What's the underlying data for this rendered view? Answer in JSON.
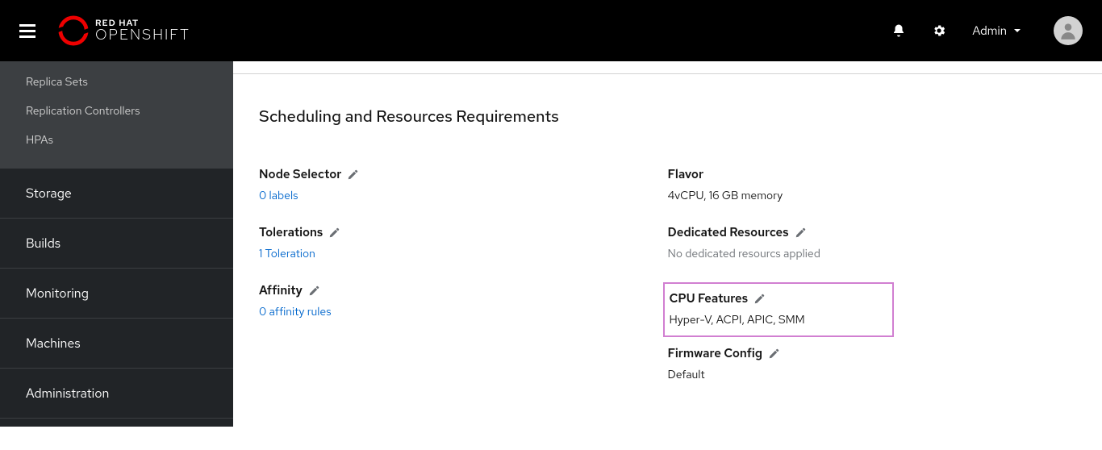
{
  "header": {
    "brand_top": "RED HAT",
    "brand_bottom": "OPENSHIFT",
    "user_label": "Admin"
  },
  "sidebar": {
    "sub_items": [
      "Replica Sets",
      "Replication Controllers",
      "HPAs"
    ],
    "main_items": [
      "Storage",
      "Builds",
      "Monitoring",
      "Machines",
      "Administration"
    ]
  },
  "main": {
    "section_title": "Scheduling and Resources Requirements",
    "left": {
      "node_selector": {
        "label": "Node Selector",
        "value": "0 labels"
      },
      "tolerations": {
        "label": "Tolerations",
        "value": "1 Toleration"
      },
      "affinity": {
        "label": "Affinity",
        "value": "0 affinity rules"
      }
    },
    "right": {
      "flavor": {
        "label": "Flavor",
        "value": "4vCPU, 16 GB memory"
      },
      "dedicated": {
        "label": "Dedicated Resources",
        "value": "No dedicated resourcs applied"
      },
      "cpu_features": {
        "label": "CPU Features",
        "value": "Hyper-V, ACPI, APIC, SMM"
      },
      "firmware": {
        "label": "Firmware Config",
        "value": "Default"
      }
    }
  }
}
